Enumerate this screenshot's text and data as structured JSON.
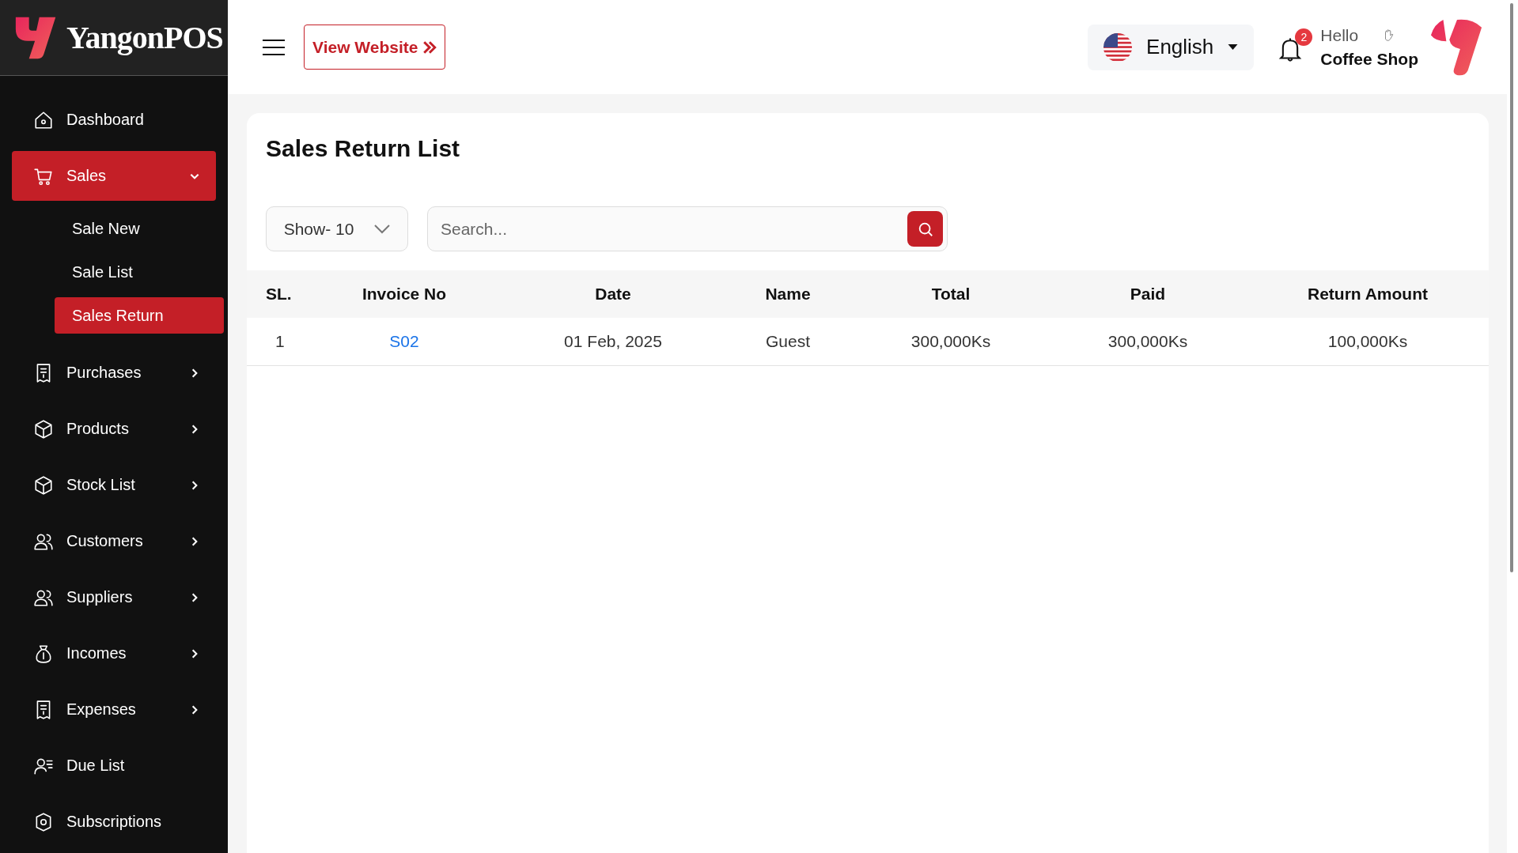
{
  "brand": {
    "name": "YangonPOS"
  },
  "sidebar": {
    "items": [
      {
        "label": "Dashboard",
        "kind": "link",
        "selected": false
      },
      {
        "label": "Sales",
        "kind": "group",
        "selected": true,
        "expanded": true,
        "children": [
          {
            "label": "Sale New",
            "selected": false
          },
          {
            "label": "Sale List",
            "selected": false
          },
          {
            "label": "Sales Return",
            "selected": true
          }
        ]
      },
      {
        "label": "Purchases",
        "kind": "group",
        "selected": false,
        "expanded": false
      },
      {
        "label": "Products",
        "kind": "group",
        "selected": false,
        "expanded": false
      },
      {
        "label": "Stock List",
        "kind": "group",
        "selected": false,
        "expanded": false
      },
      {
        "label": "Customers",
        "kind": "group",
        "selected": false,
        "expanded": false
      },
      {
        "label": "Suppliers",
        "kind": "group",
        "selected": false,
        "expanded": false
      },
      {
        "label": "Incomes",
        "kind": "group",
        "selected": false,
        "expanded": false
      },
      {
        "label": "Expenses",
        "kind": "group",
        "selected": false,
        "expanded": false
      },
      {
        "label": "Due List",
        "kind": "link",
        "selected": false
      },
      {
        "label": "Subscriptions",
        "kind": "link",
        "selected": false
      }
    ]
  },
  "header": {
    "view_website": "View Website",
    "language": "English",
    "notification_count": "2",
    "greeting": "Hello",
    "user": "Coffee Shop"
  },
  "page": {
    "title": "Sales Return List",
    "page_size": "Show- 10",
    "search": {
      "placeholder": "Search..."
    },
    "table": {
      "columns": [
        "SL.",
        "Invoice No",
        "Date",
        "Name",
        "Total",
        "Paid",
        "Return Amount"
      ],
      "rows": [
        {
          "sl": "1",
          "invoice": "S02",
          "date": "01 Feb, 2025",
          "name": "Guest",
          "total": "300,000Ks",
          "paid": "300,000Ks",
          "return_amount": "100,000Ks"
        }
      ]
    }
  }
}
